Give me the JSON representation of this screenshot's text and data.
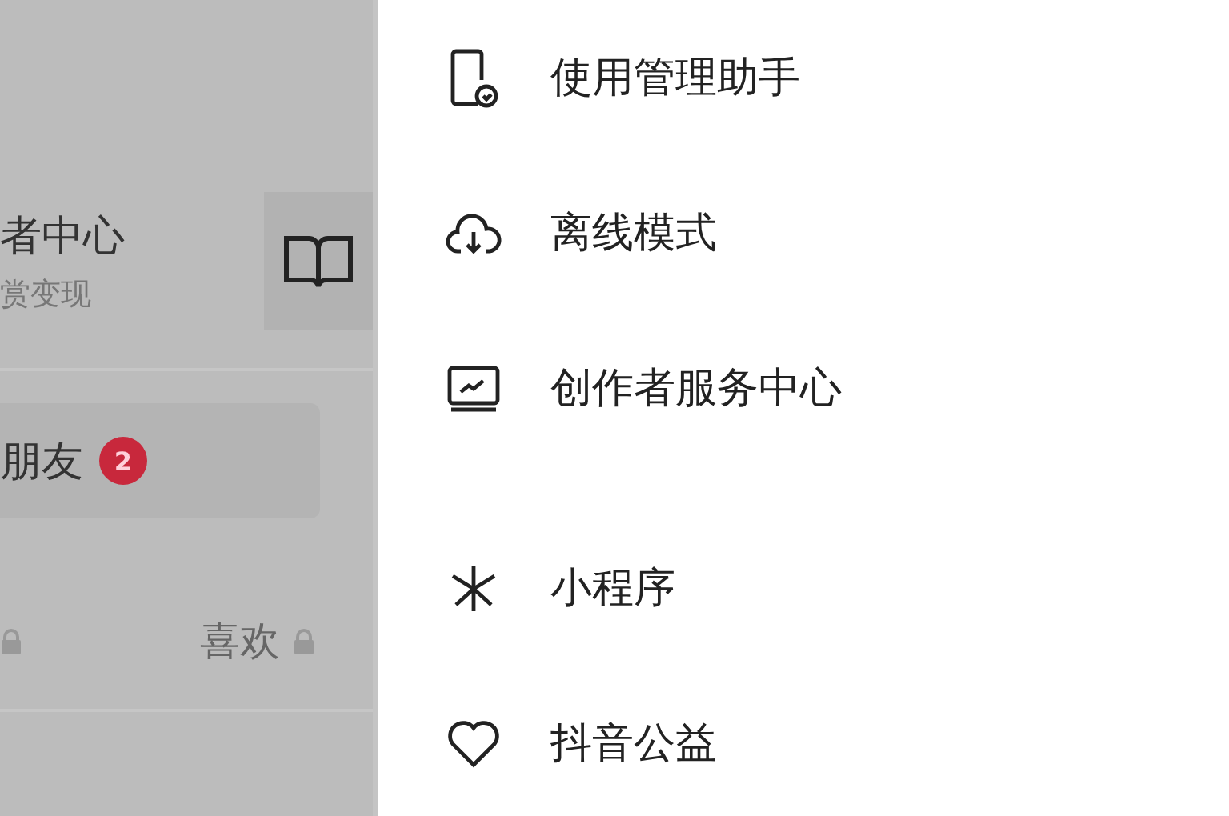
{
  "profile_panel": {
    "creator_title": "者中心",
    "creator_subtitle": "赏变现",
    "friends_button": {
      "label": "朋友",
      "badge": "2"
    },
    "tabs": [
      {
        "label": "喜欢",
        "locked": true
      }
    ]
  },
  "menu": {
    "sections": [
      {
        "items": [
          {
            "kind": "phone",
            "label": "使用管理助手"
          },
          {
            "kind": "cloud",
            "label": "离线模式"
          },
          {
            "kind": "chart",
            "label": "创作者服务中心"
          }
        ]
      },
      {
        "items": [
          {
            "kind": "mini",
            "label": "小程序"
          },
          {
            "kind": "heart",
            "label": "抖音公益"
          }
        ]
      }
    ]
  }
}
